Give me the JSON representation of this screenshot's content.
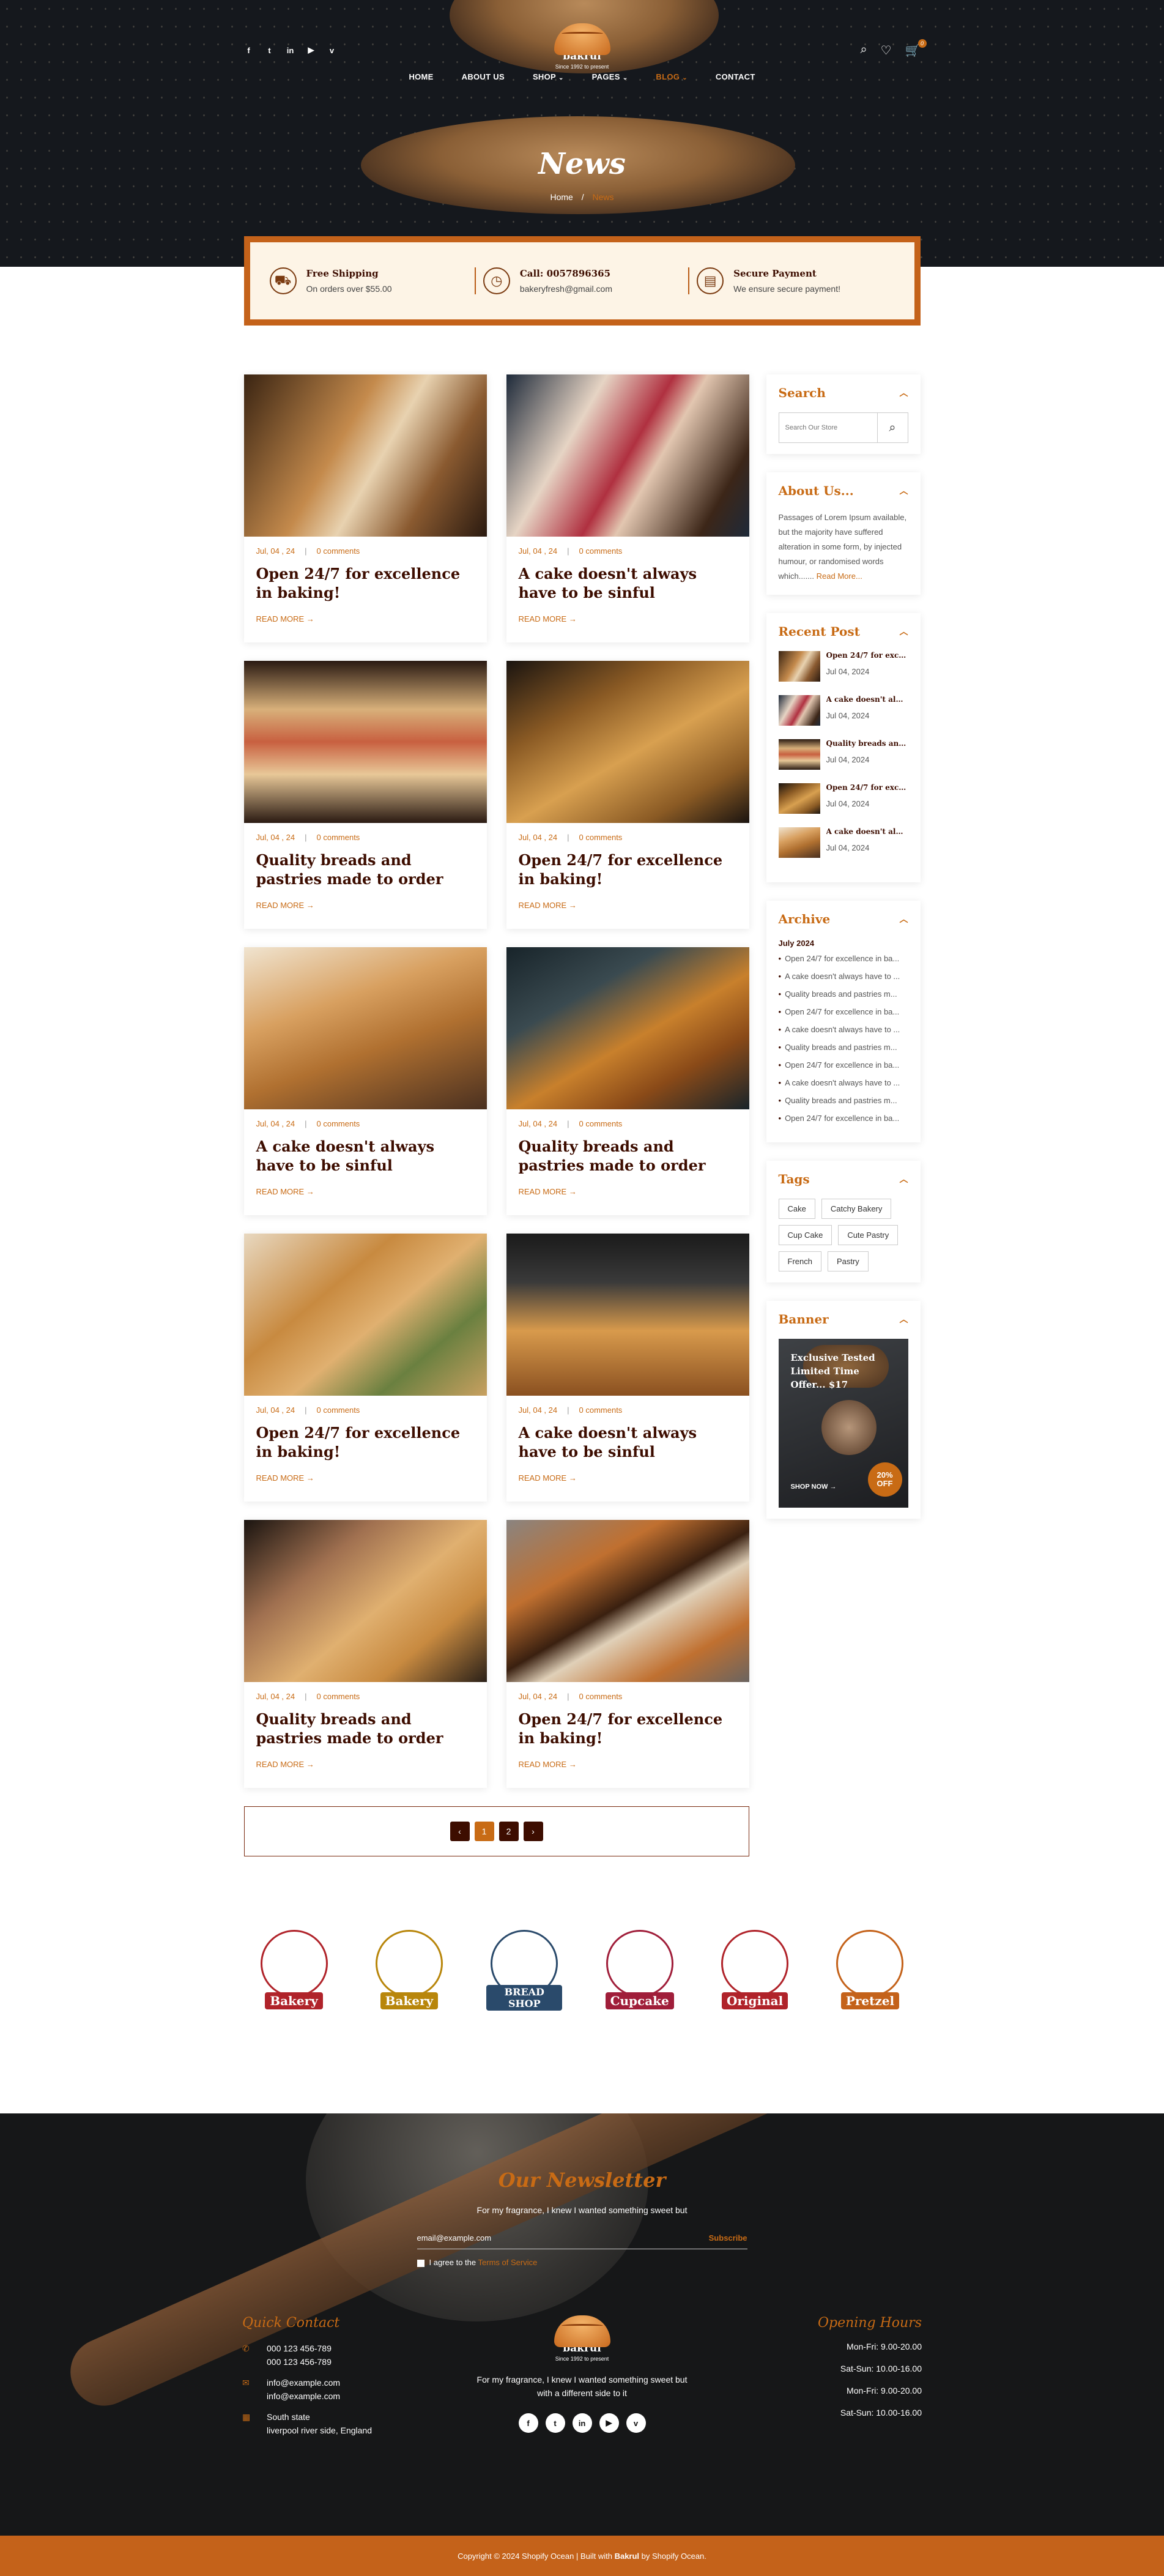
{
  "header": {
    "social": [
      "f",
      "t",
      "in",
      "yt",
      "v"
    ],
    "logo": {
      "name": "bakrul",
      "sub": "Since 1992 to present"
    },
    "cart_count": "0",
    "nav": [
      {
        "label": "HOME",
        "caret": false,
        "active": false
      },
      {
        "label": "ABOUT US",
        "caret": false,
        "active": false
      },
      {
        "label": "SHOP",
        "caret": true,
        "active": false
      },
      {
        "label": "PAGES",
        "caret": true,
        "active": false
      },
      {
        "label": "BLOG",
        "caret": true,
        "active": true
      },
      {
        "label": "CONTACT",
        "caret": false,
        "active": false
      }
    ],
    "page_title": "News",
    "breadcrumb": {
      "home": "Home",
      "sep": "/",
      "current": "News"
    }
  },
  "features": [
    {
      "icon": "truck-icon",
      "title": "Free Shipping",
      "sub": "On orders over $55.00"
    },
    {
      "icon": "clock-icon",
      "title": "Call: 0057896365",
      "sub": "bakeryfresh@gmail.com"
    },
    {
      "icon": "wallet-icon",
      "title": "Secure Payment",
      "sub": "We ensure secure payment!"
    }
  ],
  "posts": [
    {
      "date": "Jul, 04 , 24",
      "comments": "0 comments",
      "title": "Open 24/7 for excellence in baking!",
      "more": "READ MORE →",
      "thumb": "thumb-a"
    },
    {
      "date": "Jul, 04 , 24",
      "comments": "0 comments",
      "title": "A cake doesn't always have to be sinful",
      "more": "READ MORE →",
      "thumb": "thumb-b"
    },
    {
      "date": "Jul, 04 , 24",
      "comments": "0 comments",
      "title": "Quality breads and pastries made to order",
      "more": "READ MORE →",
      "thumb": "thumb-c"
    },
    {
      "date": "Jul, 04 , 24",
      "comments": "0 comments",
      "title": "Open 24/7 for excellence in baking!",
      "more": "READ MORE →",
      "thumb": "thumb-d"
    },
    {
      "date": "Jul, 04 , 24",
      "comments": "0 comments",
      "title": "A cake doesn't always have to be sinful",
      "more": "READ MORE →",
      "thumb": "thumb-e"
    },
    {
      "date": "Jul, 04 , 24",
      "comments": "0 comments",
      "title": "Quality breads and pastries made to order",
      "more": "READ MORE →",
      "thumb": "thumb-f"
    },
    {
      "date": "Jul, 04 , 24",
      "comments": "0 comments",
      "title": "Open 24/7 for excellence in baking!",
      "more": "READ MORE →",
      "thumb": "thumb-g"
    },
    {
      "date": "Jul, 04 , 24",
      "comments": "0 comments",
      "title": "A cake doesn't always have to be sinful",
      "more": "READ MORE →",
      "thumb": "thumb-h"
    },
    {
      "date": "Jul, 04 , 24",
      "comments": "0 comments",
      "title": "Quality breads and pastries made to order",
      "more": "READ MORE →",
      "thumb": "thumb-i"
    },
    {
      "date": "Jul, 04 , 24",
      "comments": "0 comments",
      "title": "Open 24/7 for excellence in baking!",
      "more": "READ MORE →",
      "thumb": "thumb-j"
    }
  ],
  "pagination": {
    "prev": "‹",
    "pages": [
      "1",
      "2"
    ],
    "current": "1",
    "next": "›"
  },
  "sidebar": {
    "search": {
      "title": "Search",
      "placeholder": "Search Our Store"
    },
    "about": {
      "title": "About Us...",
      "text": "Passages of Lorem Ipsum available, but the majority have suffered alteration in some form, by injected humour, or randomised words which.......",
      "more": "Read More..."
    },
    "recent": {
      "title": "Recent Post",
      "items": [
        {
          "title": "Open 24/7 for excell...",
          "date": "Jul 04, 2024"
        },
        {
          "title": "A cake doesn't alwa...",
          "date": "Jul 04, 2024"
        },
        {
          "title": "Quality breads and p...",
          "date": "Jul 04, 2024"
        },
        {
          "title": "Open 24/7 for excell...",
          "date": "Jul 04, 2024"
        },
        {
          "title": "A cake doesn't alwa...",
          "date": "Jul 04, 2024"
        }
      ]
    },
    "archive": {
      "title": "Archive",
      "month": "July 2024",
      "items": [
        "Open 24/7 for excellence in ba...",
        "A cake doesn't always have to ...",
        "Quality breads and pastries m...",
        "Open 24/7 for excellence in ba...",
        "A cake doesn't always have to ...",
        "Quality breads and pastries m...",
        "Open 24/7 for excellence in ba...",
        "A cake doesn't always have to ...",
        "Quality breads and pastries m...",
        "Open 24/7 for excellence in ba..."
      ]
    },
    "tags": {
      "title": "Tags",
      "items": [
        "Cake",
        "Catchy Bakery",
        "Cup Cake",
        "Cute Pastry",
        "French",
        "Pastry"
      ]
    },
    "banner": {
      "title": "Banner",
      "text": "Exclusive Tested Limited Time Offer... $17",
      "cta": "SHOP NOW →",
      "badge_pct": "20%",
      "badge_off": "OFF"
    }
  },
  "brand_logos": [
    {
      "name": "Bakery",
      "color": "#b0232a"
    },
    {
      "name": "Bakery",
      "color": "#b8860b"
    },
    {
      "name": "BREAD SHOP",
      "color": "#2a4a6b"
    },
    {
      "name": "Cupcake",
      "color": "#a01e3a"
    },
    {
      "name": "Original",
      "color": "#b0232a"
    },
    {
      "name": "Pretzel",
      "color": "#c4621a"
    }
  ],
  "footer": {
    "newsletter": {
      "title": "Our Newsletter",
      "text": "For my fragrance, I knew I wanted something sweet but",
      "email": "email@example.com",
      "subscribe": "Subscribe",
      "agree": "I agree to the",
      "terms": "Terms of Service"
    },
    "quick_contact": {
      "title": "Quick Contact",
      "phone1": "000 123 456-789",
      "phone2": "000 123 456-789",
      "mail1": "info@example.com",
      "mail2": "info@example.com",
      "addr1": "South state",
      "addr2": "liverpool river side, England"
    },
    "logo": {
      "name": "bakrul",
      "sub": "Since 1992 to present"
    },
    "about": "For my fragrance, I knew I wanted something sweet but with a different side to it",
    "social": [
      "f",
      "t",
      "in",
      "yt",
      "v"
    ],
    "hours": {
      "title": "Opening Hours",
      "rows": [
        "Mon-Fri: 9.00-20.00",
        "Sat-Sun: 10.00-16.00",
        "Mon-Fri: 9.00-20.00",
        "Sat-Sun: 10.00-16.00"
      ]
    },
    "copyright_pre": "Copyright © 2024 Shopify Ocean | Built with",
    "copyright_brand": "Bakrul",
    "copyright_post": "by Shopify Ocean."
  },
  "colors": {
    "accent": "#c86b15",
    "dark": "#3d0d00",
    "hero_bg": "#15181d"
  }
}
